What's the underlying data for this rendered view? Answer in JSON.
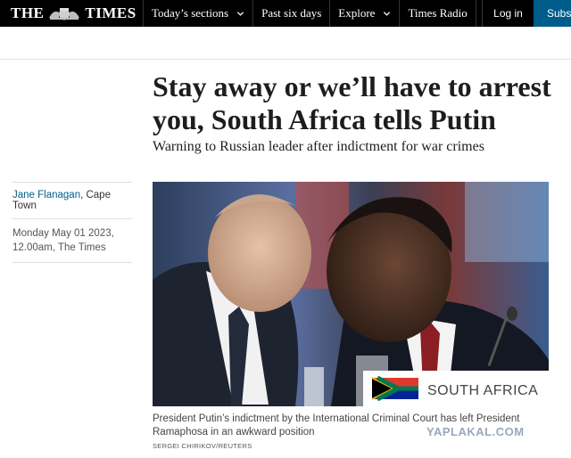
{
  "nav": {
    "logo_left": "THE",
    "logo_right": "TIMES",
    "items": [
      {
        "label": "Today’s sections"
      },
      {
        "label": "Past six days"
      },
      {
        "label": "Explore"
      },
      {
        "label": "Times Radio"
      }
    ],
    "login": "Log in",
    "subscribe": "Subscribe"
  },
  "article": {
    "headline": "Stay away or we’ll have to arrest you, South Africa tells Putin",
    "standfirst": "Warning to Russian leader after indictment for war crimes",
    "author": "Jane Flanagan",
    "location": ", Cape Town",
    "date": "Monday May 01 2023,",
    "time_source": "12.00am, The Times"
  },
  "photo": {
    "placard_text": "SOUTH AFRICA",
    "caption": "President Putin’s indictment by the International Criminal Court has left President Ramaphosa in an awkward position",
    "credit": "SERGEI CHIRIKOV/REUTERS"
  },
  "watermark": "YAPLAKAL.COM",
  "colors": {
    "nav_bg": "#000000",
    "subscribe_bg": "#005c8a",
    "link": "#005c8a"
  }
}
